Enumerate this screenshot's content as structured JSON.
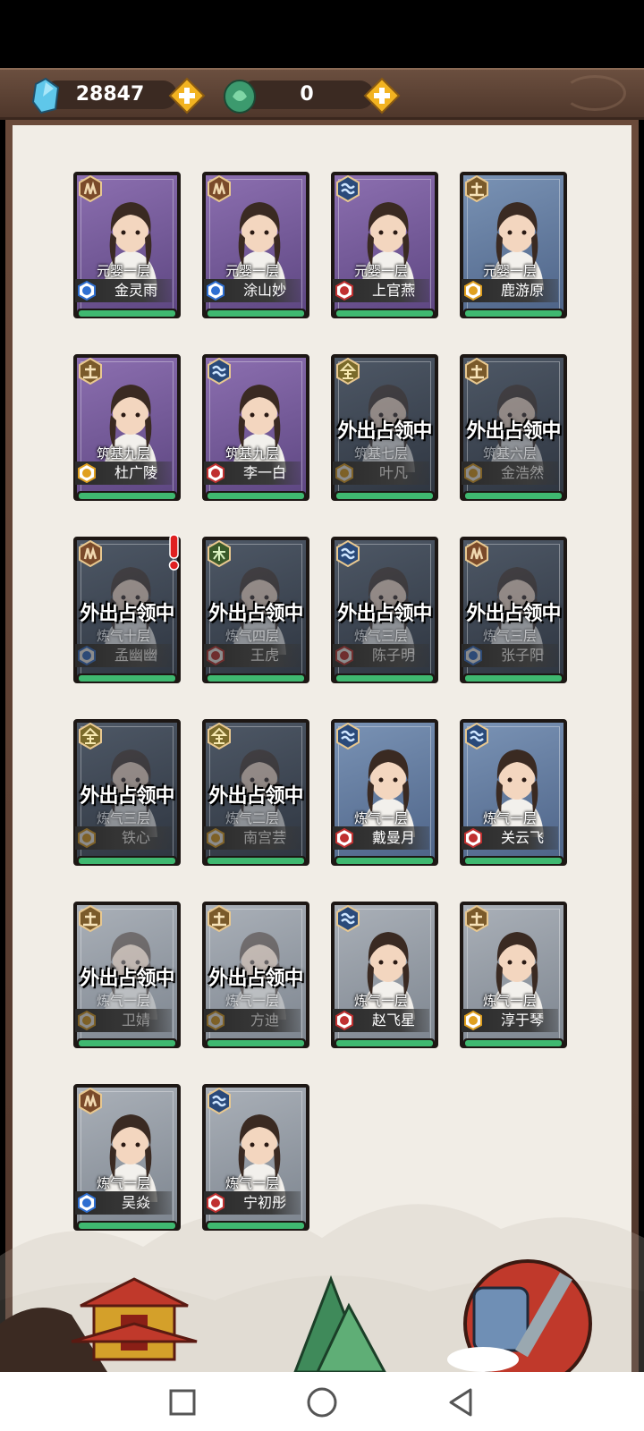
{
  "currency": {
    "spirit_stones": "28847",
    "jade": "0"
  },
  "cards": [
    {
      "realm": "元婴一层",
      "name": "金灵雨",
      "element": "fire",
      "frame": "purple",
      "away_text": "",
      "away": false,
      "alert": false
    },
    {
      "realm": "元婴一层",
      "name": "涂山妙",
      "element": "fire",
      "frame": "purple",
      "away_text": "",
      "away": false,
      "alert": false
    },
    {
      "realm": "元婴一层",
      "name": "上官燕",
      "element": "water",
      "frame": "purple",
      "away_text": "",
      "away": false,
      "alert": false
    },
    {
      "realm": "元婴一层",
      "name": "鹿游原",
      "element": "earth",
      "frame": "blue",
      "away_text": "",
      "away": false,
      "alert": false
    },
    {
      "realm": "筑基九层",
      "name": "杜广陵",
      "element": "earth",
      "frame": "purple",
      "away_text": "",
      "away": false,
      "alert": false
    },
    {
      "realm": "筑基九层",
      "name": "李一白",
      "element": "water",
      "frame": "purple",
      "away_text": "",
      "away": false,
      "alert": false
    },
    {
      "realm": "筑基七层",
      "name": "叶凡",
      "element": "metal",
      "frame": "dark",
      "away_text": "外出占领中",
      "away": true,
      "alert": false
    },
    {
      "realm": "筑基六层",
      "name": "金浩然",
      "element": "earth",
      "frame": "dark",
      "away_text": "外出占领中",
      "away": true,
      "alert": false
    },
    {
      "realm": "炼气十层",
      "name": "孟幽幽",
      "element": "fire",
      "frame": "dark",
      "away_text": "外出占领中",
      "away": true,
      "alert": true
    },
    {
      "realm": "炼气四层",
      "name": "王虎",
      "element": "wood",
      "frame": "dark",
      "away_text": "外出占领中",
      "away": true,
      "alert": false
    },
    {
      "realm": "炼气三层",
      "name": "陈子明",
      "element": "water",
      "frame": "dark",
      "away_text": "外出占领中",
      "away": true,
      "alert": false
    },
    {
      "realm": "炼气三层",
      "name": "张子阳",
      "element": "fire",
      "frame": "dark",
      "away_text": "外出占领中",
      "away": true,
      "alert": false
    },
    {
      "realm": "炼气三层",
      "name": "铁心",
      "element": "metal",
      "frame": "dark",
      "away_text": "外出占领中",
      "away": true,
      "alert": false
    },
    {
      "realm": "炼气二层",
      "name": "南宫芸",
      "element": "metal",
      "frame": "dark",
      "away_text": "外出占领中",
      "away": true,
      "alert": false
    },
    {
      "realm": "炼气一层",
      "name": "戴曼月",
      "element": "water",
      "frame": "blue",
      "away_text": "",
      "away": false,
      "alert": false
    },
    {
      "realm": "炼气一层",
      "name": "关云飞",
      "element": "water",
      "frame": "blue",
      "away_text": "",
      "away": false,
      "alert": false
    },
    {
      "realm": "炼气一层",
      "name": "卫婧",
      "element": "earth",
      "frame": "gray",
      "away_text": "外出占领中",
      "away": true,
      "alert": false
    },
    {
      "realm": "炼气一层",
      "name": "方迪",
      "element": "earth",
      "frame": "gray",
      "away_text": "外出占领中",
      "away": true,
      "alert": false
    },
    {
      "realm": "炼气一层",
      "name": "赵飞星",
      "element": "water",
      "frame": "gray",
      "away_text": "",
      "away": false,
      "alert": false
    },
    {
      "realm": "炼气一层",
      "name": "淳于琴",
      "element": "earth",
      "frame": "gray",
      "away_text": "",
      "away": false,
      "alert": false
    },
    {
      "realm": "炼气一层",
      "name": "吴焱",
      "element": "fire",
      "frame": "gray",
      "away_text": "",
      "away": false,
      "alert": false
    },
    {
      "realm": "炼气一层",
      "name": "宁初彤",
      "element": "water",
      "frame": "gray",
      "away_text": "",
      "away": false,
      "alert": false
    }
  ],
  "colors": {
    "accent_gold": "#f2b321",
    "hp_green": "#3fb870"
  }
}
